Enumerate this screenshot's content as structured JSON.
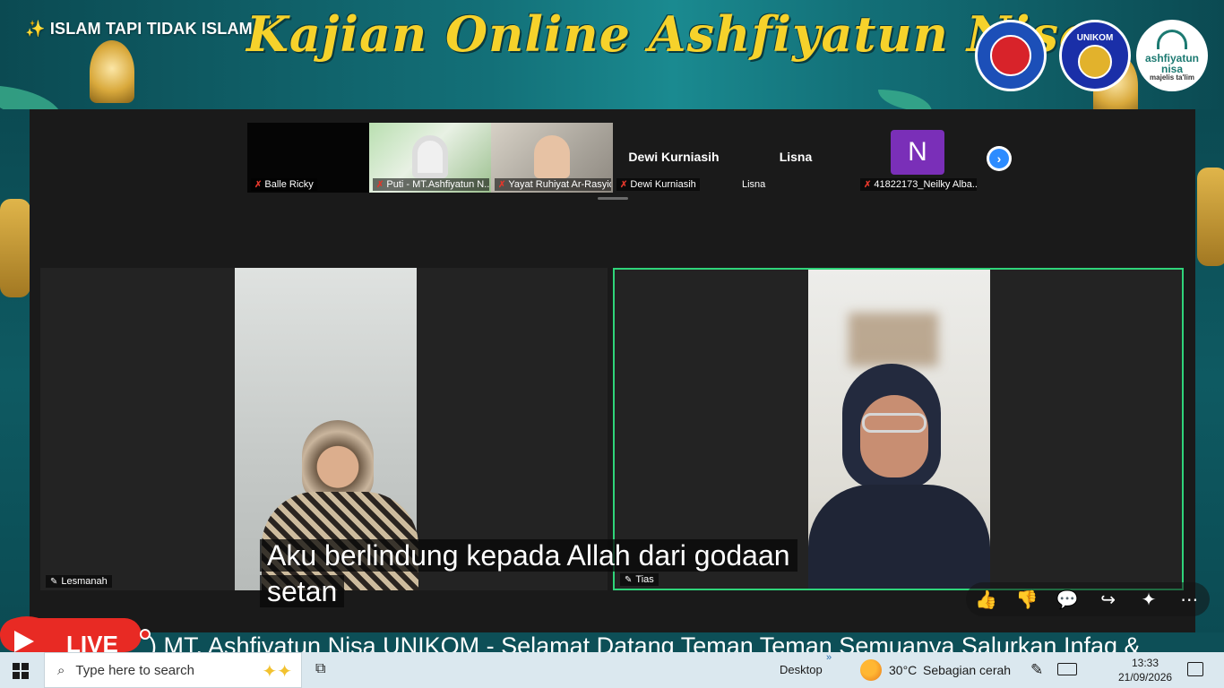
{
  "banner": {
    "channel_title": "ISLAM TAPI TIDAK ISLAM",
    "sparkle": "✨",
    "title": "Kajian Online Ashfiyatun Nisa",
    "logos": {
      "yipt": "YIPT",
      "unikom": "UNIKOM",
      "ashf_name": "ashfiyatun nisa",
      "ashf_sub": "majelis ta'lim"
    }
  },
  "meeting": {
    "thumbnails": [
      {
        "name": "Balle Ricky",
        "type": "black",
        "muted": true
      },
      {
        "name": "Puti - MT.Ashfiyatun N...",
        "type": "video",
        "muted": true
      },
      {
        "name": "Yayat Ruhiyat Ar-Rasyid",
        "type": "video",
        "muted": true
      },
      {
        "name": "Dewi Kurniasih",
        "center": "Dewi Kurniasih",
        "type": "name",
        "muted": true
      },
      {
        "name": "Lisna",
        "center": "Lisna",
        "type": "name",
        "muted": false
      },
      {
        "name": "41822173_Neilky Alba...",
        "avatar": "N",
        "type": "avatar",
        "muted": true
      }
    ],
    "next_glyph": "›",
    "mic_off_glyph": "✗",
    "tiles": [
      {
        "name": "Lesmanah",
        "pinned": true
      },
      {
        "name": "Tias",
        "pinned": true,
        "active_speaker": true
      }
    ],
    "pin_glyph": "✎"
  },
  "caption": {
    "line1": "Aku berlindung kepada Allah dari godaan",
    "line2": "setan"
  },
  "youtube": {
    "actions": [
      {
        "name": "like-icon",
        "glyph": "👍"
      },
      {
        "name": "dislike-icon",
        "glyph": "👎"
      },
      {
        "name": "comment-icon",
        "glyph": "💬"
      },
      {
        "name": "share-icon",
        "glyph": "↪"
      },
      {
        "name": "sparkle-icon",
        "glyph": "✦"
      },
      {
        "name": "more-icon",
        "glyph": "⋯"
      }
    ],
    "live_label": "LIVE",
    "ticker": ") MT. Ashfiyatun Nisa UNIKOM - Selamat Datang Teman Teman Semuanya Salurkan Infaq &"
  },
  "taskbar": {
    "search_placeholder": "Type here to search",
    "search_glyph": "⌕",
    "search_art": "✦✦",
    "taskview_glyph": "⧉",
    "desktop_label": "Desktop",
    "chevron": "»",
    "temperature": "30°C",
    "weather": "Sebagian cerah",
    "pen_glyph": "✎",
    "time": "13:33",
    "date": "21/09/2026"
  },
  "colors": {
    "banner_bg": "#137078",
    "banner_title": "#f6d22b",
    "active_speaker_border": "#2fd47a",
    "live_red": "#e82a24",
    "taskbar": "#dbe8ef"
  }
}
